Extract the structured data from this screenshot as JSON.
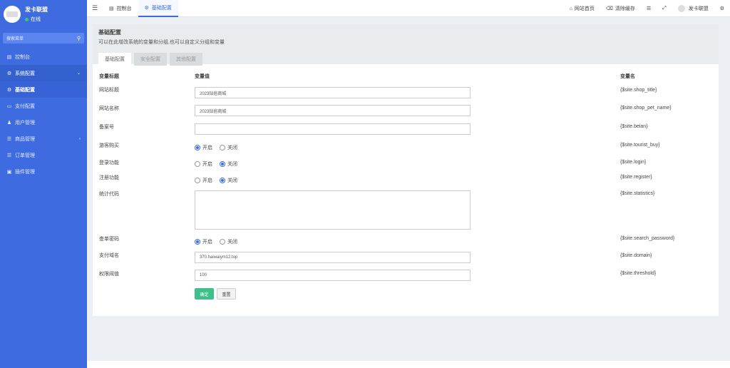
{
  "sidebar": {
    "brand_name": "发卡联盟",
    "status": "在线",
    "search_placeholder": "搜索菜单",
    "items": [
      {
        "label": "控制台",
        "icon": "dashboard-icon"
      },
      {
        "label": "系统配置",
        "icon": "gear-icon"
      },
      {
        "label": "基础配置",
        "icon": "gear-icon"
      },
      {
        "label": "支付配置",
        "icon": "card-icon"
      },
      {
        "label": "用户管理",
        "icon": "user-icon"
      },
      {
        "label": "商品管理",
        "icon": "cart-icon"
      },
      {
        "label": "订单管理",
        "icon": "list-icon"
      },
      {
        "label": "插件管理",
        "icon": "puzzle-icon"
      }
    ]
  },
  "topbar": {
    "tabs": [
      {
        "label": "控制台",
        "icon": "dashboard-icon"
      },
      {
        "label": "基础配置",
        "icon": "gear-icon"
      }
    ],
    "right": {
      "home": "网站首页",
      "clear_cache": "清除缓存",
      "user": "发卡联盟"
    }
  },
  "panel": {
    "title": "基础配置",
    "description": "可以在此增改系统的变量和分组,也可以自定义分组和变量",
    "tabs": [
      "基础配置",
      "安全配置",
      "其他配置"
    ],
    "headers": {
      "label": "变量标题",
      "value": "变量值",
      "var": "变量名"
    },
    "rows": [
      {
        "label": "网站标题",
        "value": "2023钻俗商城",
        "var": "{$site.shop_title}"
      },
      {
        "label": "网站名称",
        "value": "2023钻俗商城",
        "var": "{$site.shop_pet_name}"
      },
      {
        "label": "备案号",
        "value": "",
        "var": "{$site.beian}"
      },
      {
        "label": "游客购买",
        "var": "{$site.tourist_buy}",
        "on": "开启",
        "off": "关闭",
        "selected": "on"
      },
      {
        "label": "登录功能",
        "var": "{$site.login}",
        "on": "开启",
        "off": "关闭",
        "selected": "off"
      },
      {
        "label": "注册功能",
        "var": "{$site.register}",
        "on": "开启",
        "off": "关闭",
        "selected": "off"
      },
      {
        "label": "统计代码",
        "value": "",
        "var": "{$site.statistics}"
      },
      {
        "label": "查单密码",
        "var": "{$site.search_password}",
        "on": "开启",
        "off": "关闭",
        "selected": "on"
      },
      {
        "label": "支付域名",
        "value": "370.haiwaiym12.top",
        "var": "{$site.domain}"
      },
      {
        "label": "权限阈值",
        "value": "100",
        "var": "{$site.threshold}"
      }
    ],
    "submit": "确定",
    "reset": "重置"
  }
}
